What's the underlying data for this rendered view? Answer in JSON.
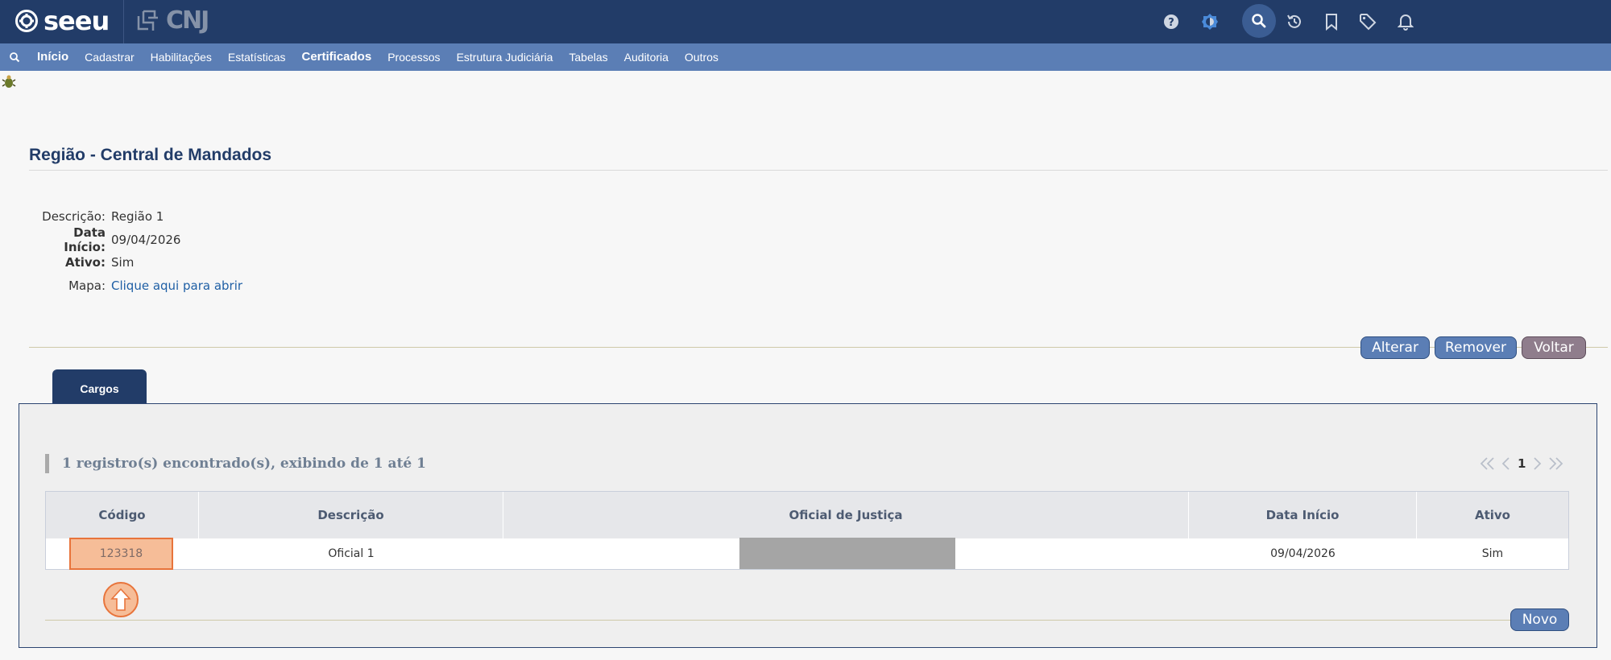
{
  "header": {
    "logo_text": "seeu",
    "partner_logo": "CNJ",
    "icons": [
      "help-icon",
      "theme-icon",
      "search-icon",
      "history-icon",
      "bookmark-icon",
      "tag-icon",
      "bell-icon"
    ]
  },
  "menu": {
    "items": [
      "Início",
      "Cadastrar",
      "Habilitações",
      "Estatísticas",
      "Certificados",
      "Processos",
      "Estrutura Judiciária",
      "Tabelas",
      "Auditoria",
      "Outros"
    ]
  },
  "page": {
    "title": "Região - Central de Mandados"
  },
  "details": {
    "descricao_label": "Descrição:",
    "descricao_value": "Região 1",
    "data_inicio_label": "Data Início:",
    "data_inicio_value": "09/04/2026",
    "ativo_label": "Ativo:",
    "ativo_value": "Sim",
    "mapa_label": "Mapa:",
    "mapa_link": "Clique aqui para abrir"
  },
  "actions": {
    "alterar": "Alterar",
    "remover": "Remover",
    "voltar": "Voltar"
  },
  "tabs": [
    {
      "label": "Cargos",
      "active": true
    }
  ],
  "records": {
    "summary": "1 registro(s) encontrado(s), exibindo de 1 até 1",
    "page": "1"
  },
  "table": {
    "headers": [
      "Código",
      "Descrição",
      "Oficial de Justiça",
      "Data Início",
      "Ativo"
    ],
    "rows": [
      {
        "codigo": "123318",
        "descricao": "Oficial 1",
        "oficial": "",
        "data_inicio": "09/04/2026",
        "ativo": "Sim"
      }
    ]
  },
  "novo_label": "Novo",
  "colors": {
    "topbar": "#223c68",
    "menubar": "#5b7eb5",
    "highlight": "#f6bd98",
    "highlight_border": "#e8743b"
  }
}
